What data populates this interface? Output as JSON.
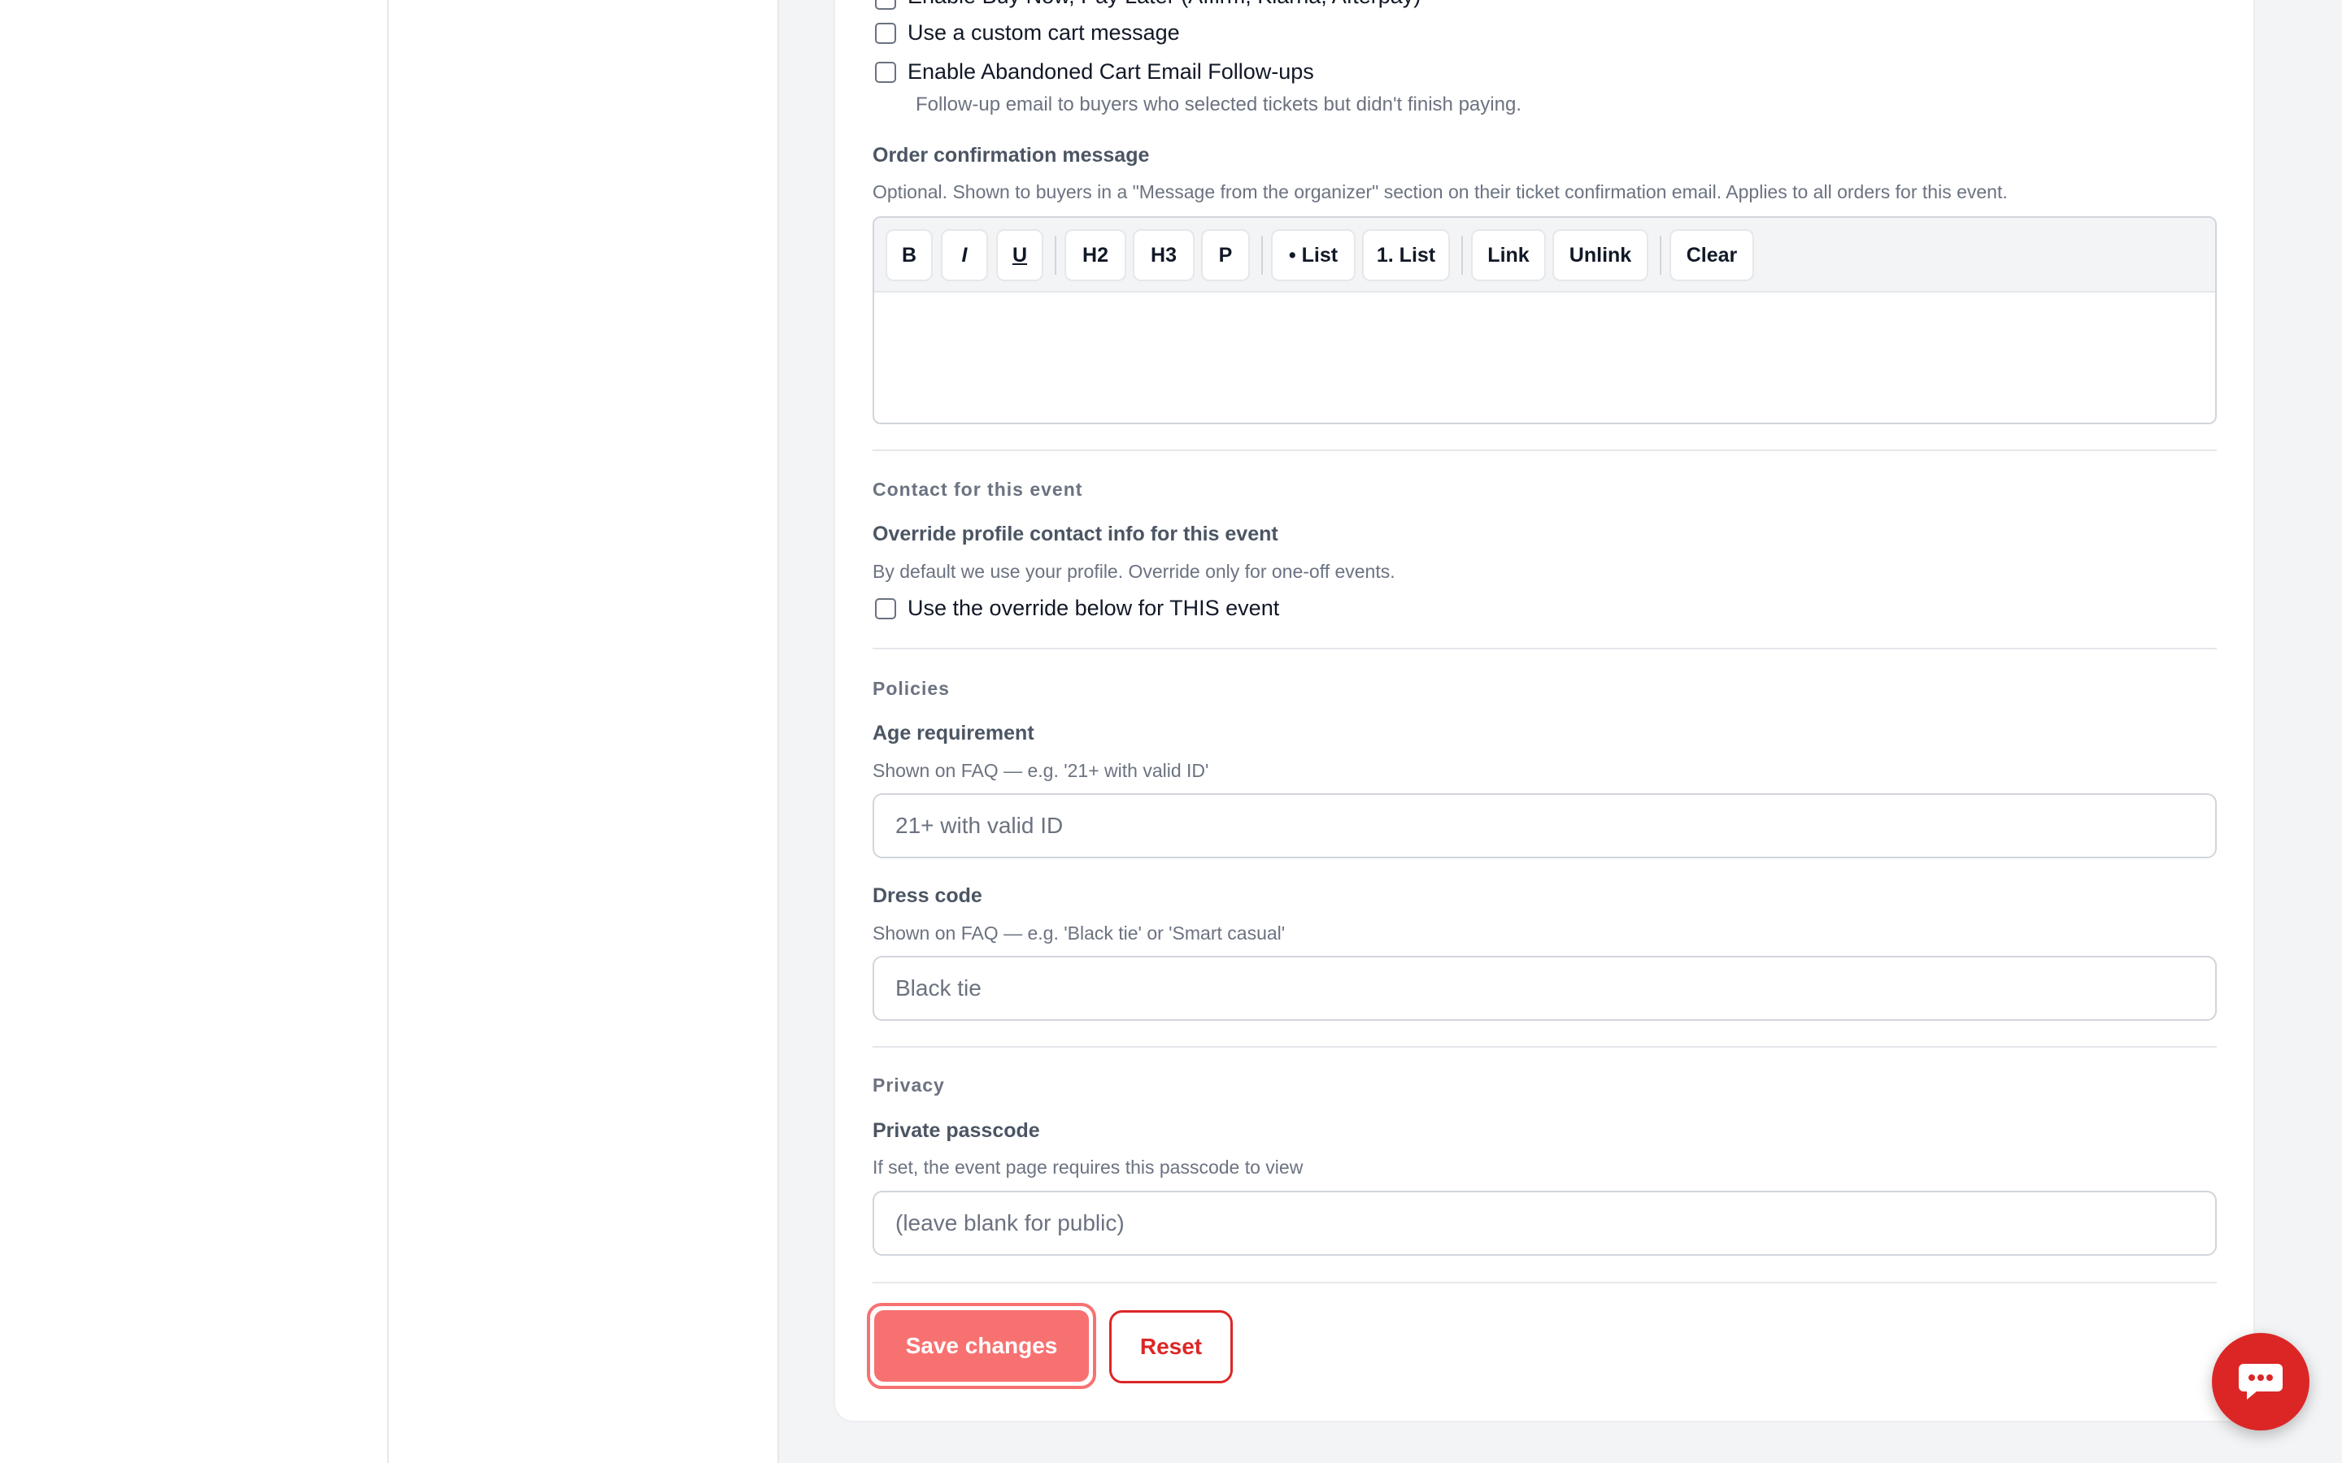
{
  "payments": {
    "checkboxes": [
      {
        "label": "Enable Buy Now, Pay Later (Affirm, Klarna, Afterpay)",
        "checked": false
      },
      {
        "label": "Use a custom cart message",
        "checked": false
      },
      {
        "label": "Enable Abandoned Cart Email Follow-ups",
        "checked": false
      }
    ],
    "abandoned_help": "Follow-up email to buyers who selected tickets but didn't finish paying."
  },
  "order_confirmation": {
    "label": "Order confirmation message",
    "help": "Optional. Shown to buyers in a \"Message from the organizer\" section on their ticket confirmation email. Applies to all orders for this event.",
    "toolbar": {
      "bold": "B",
      "italic": "I",
      "underline": "U",
      "h2": "H2",
      "h3": "H3",
      "paragraph": "P",
      "bullet_list": "• List",
      "numbered_list": "1. List",
      "link": "Link",
      "unlink": "Unlink",
      "clear": "Clear"
    },
    "content": ""
  },
  "contact": {
    "section_title": "Contact for this event",
    "label": "Override profile contact info for this event",
    "help": "By default we use your profile. Override only for one-off events.",
    "checkbox_label": "Use the override below for THIS event",
    "checked": false
  },
  "policies": {
    "section_title": "Policies",
    "age": {
      "label": "Age requirement",
      "help": "Shown on FAQ — e.g. '21+ with valid ID'",
      "placeholder": "21+ with valid ID"
    },
    "dress": {
      "label": "Dress code",
      "help": "Shown on FAQ — e.g. 'Black tie' or 'Smart casual'",
      "placeholder": "Black tie"
    }
  },
  "privacy": {
    "section_title": "Privacy",
    "passcode": {
      "label": "Private passcode",
      "help": "If set, the event page requires this passcode to view",
      "placeholder": "(leave blank for public)"
    }
  },
  "actions": {
    "save_label": "Save changes",
    "reset_label": "Reset"
  },
  "chat": {
    "icon": "chat-bubble-icon"
  },
  "colors": {
    "accent": "#f87171",
    "danger": "#dc2626"
  }
}
